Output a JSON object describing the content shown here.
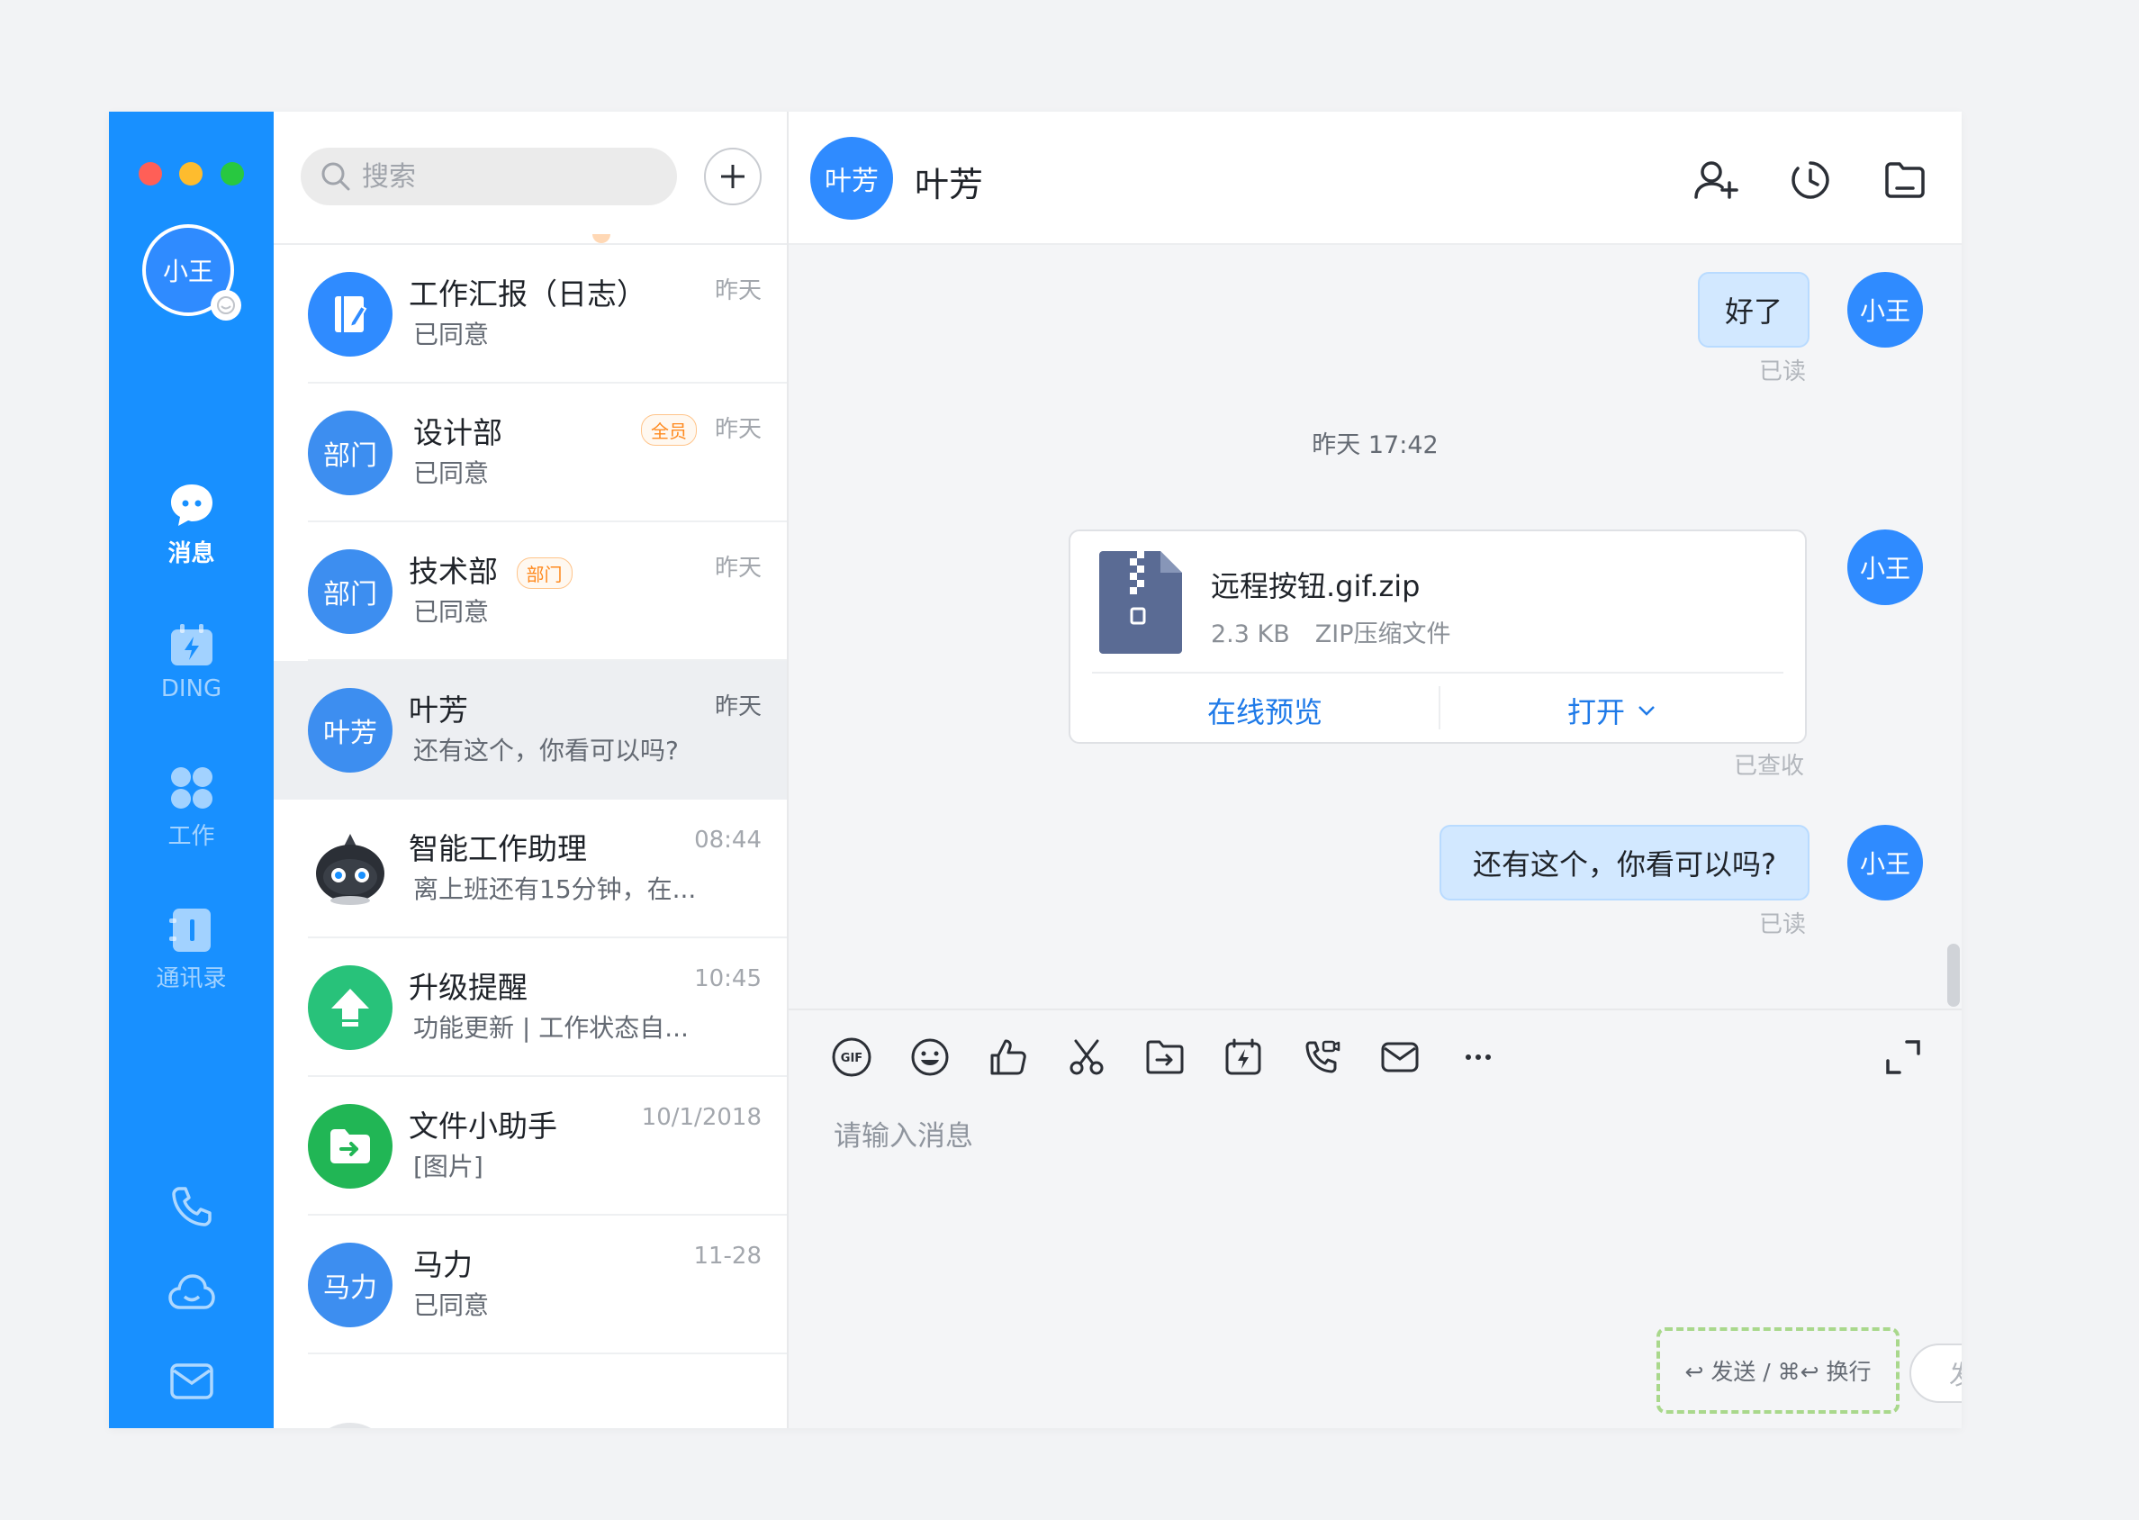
{
  "nav": {
    "me_avatar": "小王",
    "items": [
      {
        "label": "消息",
        "icon": "message-bubble-icon",
        "active": true
      },
      {
        "label": "DING",
        "icon": "ding-calendar-icon",
        "active": false
      },
      {
        "label": "工作",
        "icon": "apps-grid-icon",
        "active": false
      },
      {
        "label": "通讯录",
        "icon": "contacts-book-icon",
        "active": false
      }
    ],
    "bottom_icons": [
      "phone-icon",
      "cloud-icon",
      "mail-icon",
      "more-icon"
    ]
  },
  "list": {
    "search_placeholder": "搜索",
    "conversations": [
      {
        "avatar": "",
        "name": "工作汇报（日志）",
        "preview": "已同意",
        "time": "昨天"
      },
      {
        "avatar": "部门",
        "name": "设计部",
        "tag": "全员",
        "preview": "已同意",
        "time": "昨天"
      },
      {
        "avatar": "部门",
        "name": "技术部",
        "tag": "部门",
        "preview": "已同意",
        "time": "昨天"
      },
      {
        "avatar": "叶芳",
        "name": "叶芳",
        "preview": "还有这个，你看可以吗?",
        "time": "昨天",
        "selected": true
      },
      {
        "avatar": "",
        "name": "智能工作助理",
        "preview": "离上班还有15分钟，在...",
        "time": "08:44"
      },
      {
        "avatar": "",
        "name": "升级提醒",
        "preview": "功能更新 | 工作状态自...",
        "time": "10:45"
      },
      {
        "avatar": "",
        "name": "文件小助手",
        "preview": "[图片]",
        "time": "10/1/2018"
      },
      {
        "avatar": "马力",
        "name": "马力",
        "preview": "已同意",
        "time": "11-28"
      }
    ]
  },
  "chat": {
    "contact_avatar": "叶芳",
    "contact_name": "叶芳",
    "messages": {
      "m1_text": "好了",
      "m1_status": "已读",
      "timestamp": "昨天 17:42",
      "file_name": "远程按钮.gif.zip",
      "file_size": "2.3 KB",
      "file_type": "ZIP压缩文件",
      "file_preview": "在线预览",
      "file_open": "打开",
      "file_status": "已查收",
      "m3_text": "还有这个，你看可以吗?",
      "m3_status": "已读",
      "sender_avatar": "小王"
    },
    "composer": {
      "placeholder": "请输入消息",
      "hint": "↩ 发送 / ⌘↩ 换行",
      "send_label": "发送"
    }
  },
  "colors": {
    "nav_blue": "#1890ff",
    "bubble_blue": "#d2e8ff",
    "link_blue": "#1f7ae8",
    "tag_orange": "#ff8a1f",
    "hint_dash_green": "#a9d88c"
  }
}
